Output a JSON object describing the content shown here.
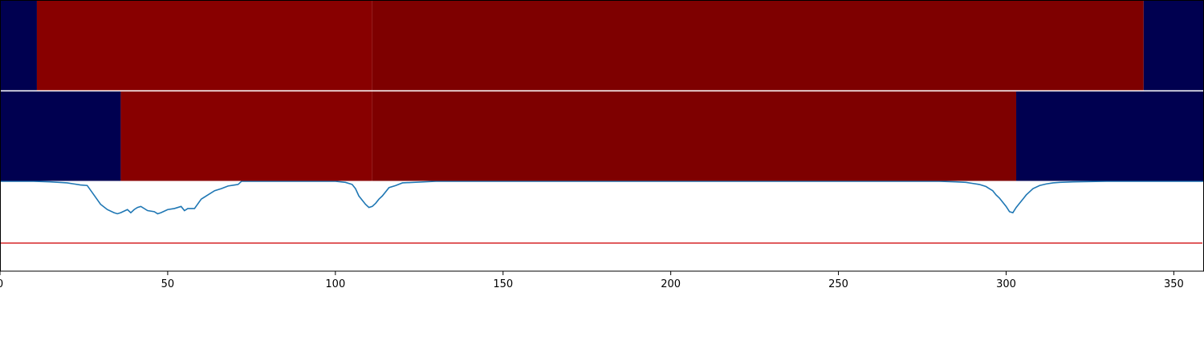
{
  "chart_data": {
    "type": "line",
    "title": "",
    "xlabel": "",
    "ylabel": "",
    "xlim": [
      0,
      359
    ],
    "xticks": [
      0,
      50,
      100,
      150,
      200,
      250,
      300,
      350
    ],
    "grid": false,
    "bands": [
      {
        "segments": [
          {
            "start": 0,
            "end": 11,
            "color": "#000050"
          },
          {
            "start": 11,
            "end": 111,
            "color": "#880000"
          },
          {
            "start": 111,
            "end": 341,
            "color": "#7e0000"
          },
          {
            "start": 341,
            "end": 359,
            "color": "#000050"
          }
        ]
      },
      {
        "segments": [
          {
            "start": 0,
            "end": 36,
            "color": "#000050"
          },
          {
            "start": 36,
            "end": 111,
            "color": "#880000"
          },
          {
            "start": 111,
            "end": 303,
            "color": "#7e0000"
          },
          {
            "start": 303,
            "end": 359,
            "color": "#000050"
          }
        ]
      }
    ],
    "ylim": [
      0,
      1
    ],
    "series": [
      {
        "color": "#1f77b4",
        "x": [
          0,
          5,
          10,
          15,
          20,
          22,
          24,
          26,
          28,
          30,
          32,
          34,
          35,
          36,
          38,
          39,
          40,
          41,
          42,
          44,
          46,
          47,
          48,
          50,
          52,
          54,
          55,
          56,
          58,
          60,
          62,
          64,
          66,
          68,
          70,
          71,
          72,
          80,
          90,
          100,
          103,
          105,
          106,
          107,
          108,
          109,
          110,
          111,
          112,
          113,
          114,
          116,
          118,
          120,
          130,
          150,
          170,
          200,
          230,
          250,
          260,
          270,
          280,
          285,
          288,
          290,
          292,
          294,
          295,
          296,
          297,
          298,
          299,
          300,
          301,
          302,
          303,
          304,
          305,
          306,
          307,
          308,
          310,
          312,
          314,
          316,
          320,
          330,
          340,
          359
        ],
        "y": [
          1.0,
          1.0,
          1.0,
          0.995,
          0.985,
          0.975,
          0.965,
          0.96,
          0.87,
          0.78,
          0.73,
          0.7,
          0.69,
          0.7,
          0.73,
          0.7,
          0.73,
          0.75,
          0.76,
          0.72,
          0.71,
          0.69,
          0.7,
          0.73,
          0.74,
          0.76,
          0.72,
          0.74,
          0.74,
          0.83,
          0.87,
          0.91,
          0.93,
          0.955,
          0.965,
          0.97,
          1.0,
          1.0,
          1.0,
          1.0,
          0.99,
          0.97,
          0.93,
          0.86,
          0.82,
          0.78,
          0.75,
          0.76,
          0.79,
          0.83,
          0.86,
          0.94,
          0.96,
          0.985,
          1.0,
          1.0,
          1.0,
          1.0,
          1.0,
          1.0,
          1.0,
          1.0,
          1.0,
          0.995,
          0.99,
          0.98,
          0.97,
          0.95,
          0.93,
          0.91,
          0.87,
          0.84,
          0.8,
          0.76,
          0.71,
          0.7,
          0.75,
          0.79,
          0.83,
          0.87,
          0.9,
          0.93,
          0.96,
          0.975,
          0.985,
          0.99,
          0.995,
          1.0,
          1.0,
          1.0
        ]
      }
    ],
    "reference_lines": [
      {
        "y": 0.41,
        "color": "#d62728"
      }
    ]
  }
}
